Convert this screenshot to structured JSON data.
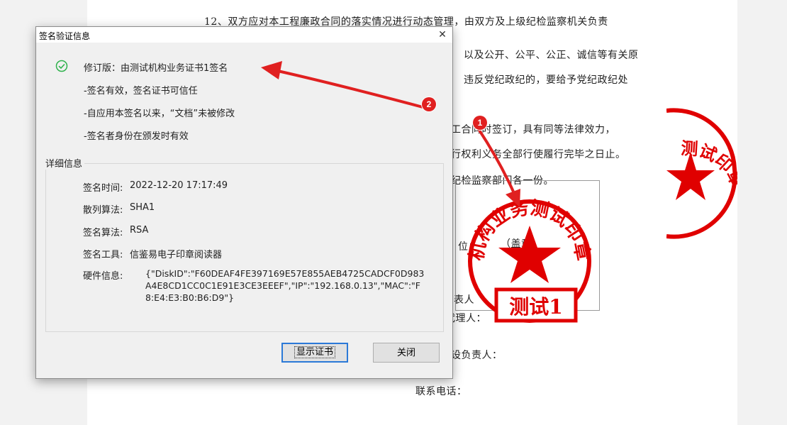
{
  "document": {
    "lines": [
      "12、双方应对本工程廉政合同的落实情况进行动态管理，由双方及上级纪检监察机关负责",
      "以及公开、公平、公正、诚信等有关原",
      "违反党纪政纪的，要给予党纪政纪处",
      "工合同时签订，具有同等法律效力，",
      "行权利义务全部行使履行完毕之日止。",
      "纪检监察部门各一份。",
      "位：",
      "（盖章）",
      "表人",
      "代理人：",
      "设负责人：",
      "联系电话："
    ],
    "seal_main": {
      "arc_text": "机构业务测试印章",
      "bottom_text": "测试1",
      "color": "#e00000"
    },
    "seal_side": {
      "arc_text": "测试印章",
      "color": "#e00000"
    }
  },
  "dialog": {
    "title": "签名验证信息",
    "close_glyph": "✕",
    "status": {
      "headline": "修订版：由测试机构业务证书1签名",
      "lines": [
        "-签名有效，签名证书可信任",
        "-自应用本签名以来，“文档”未被修改",
        "-签名者身份在颁发时有效"
      ]
    },
    "details": {
      "group_label": "详细信息",
      "sign_time_label": "签名时间:",
      "sign_time_value": "2022-12-20 17:17:49",
      "hash_label": "散列算法:",
      "hash_value": "SHA1",
      "sign_alg_label": "签名算法:",
      "sign_alg_value": "RSA",
      "tool_label": "签名工具:",
      "tool_value": "信鉴易电子印章阅读器",
      "hardware_label": "硬件信息:",
      "hardware_value": "{\"DiskID\":\"F60DEAF4FE397169E57E855AEB4725CADCF0D983A4E8CD1CC0C1E91E3CE3EEEF\",\"IP\":\"192.168.0.13\",\"MAC\":\"F8:E4:E3:B0:B6:D9\"}"
    },
    "buttons": {
      "show_cert": "显示证书",
      "close": "关闭"
    }
  },
  "annotations": {
    "badge_1": "1",
    "badge_2": "2",
    "color": "#e02020"
  },
  "colors": {
    "check": "#2fb24d",
    "focus": "#2b79d7",
    "seal": "#e00000"
  }
}
